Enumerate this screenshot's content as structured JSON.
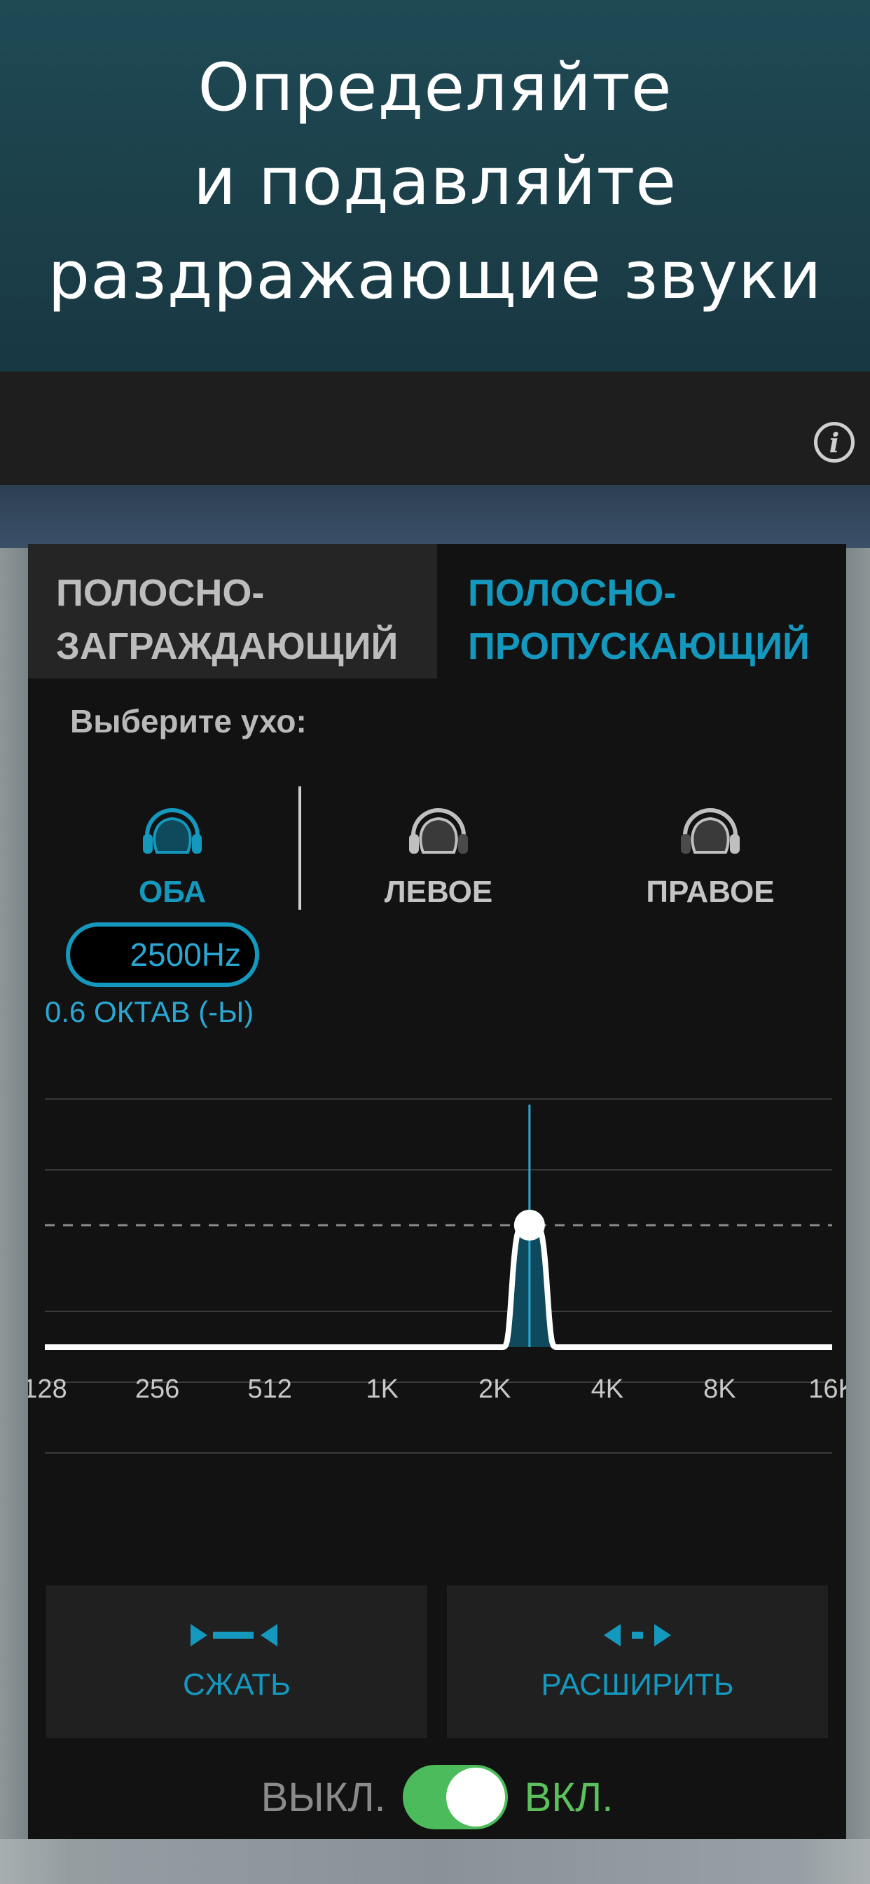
{
  "banner": {
    "title": "Определяйте\nи подавляйте\nраздражающие звуки"
  },
  "tabs": {
    "bandstop": "ПОЛОСНО-\nЗАГРАЖДАЮЩИЙ",
    "bandpass": "ПОЛОСНО-\nПРОПУСКАЮЩИЙ",
    "selected": "bandpass"
  },
  "ear": {
    "prompt": "Выберите ухо:",
    "options": [
      "ОБА",
      "ЛЕВОЕ",
      "ПРАВОЕ"
    ],
    "selected": "ОБА"
  },
  "filter": {
    "frequency": "2500Hz",
    "width": "0.6 ОКТАВ (-Ы)"
  },
  "chart_data": {
    "type": "line",
    "x_ticks": [
      "128",
      "256",
      "512",
      "1K",
      "2K",
      "4K",
      "8K",
      "16K"
    ],
    "center_frequency_hz": 2500,
    "bandwidth_octaves": 0.6,
    "grid": true
  },
  "buttons": {
    "compress": "СЖАТЬ",
    "expand": "РАСШИРИТЬ"
  },
  "toggle": {
    "off_label": "ВЫКЛ.",
    "on_label": "ВКЛ.",
    "state": "on"
  },
  "colors": {
    "accent": "#1598bd",
    "toggle_on": "#4cbb5b",
    "banner": "#1e4a55"
  },
  "icons": {
    "info": "i"
  }
}
